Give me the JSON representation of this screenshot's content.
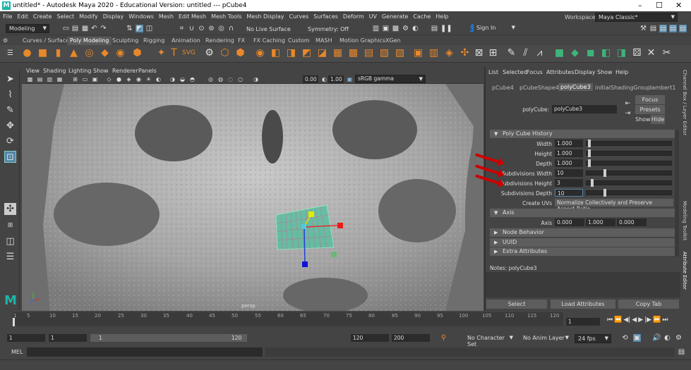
{
  "window": {
    "title": "untitled* - Autodesk Maya 2020 - Educational Version: untitled  ---  pCube4",
    "minimize": "–",
    "maximize": "☐",
    "close": "✕"
  },
  "menubar": [
    "File",
    "Edit",
    "Create",
    "Select",
    "Modify",
    "Display",
    "Windows",
    "Mesh",
    "Edit Mesh",
    "Mesh Tools",
    "Mesh Display",
    "Curves",
    "Surfaces",
    "Deform",
    "UV",
    "Generate",
    "Cache",
    "Help"
  ],
  "statusline": {
    "menuset": "Modeling",
    "live_surface": "No Live Surface",
    "symmetry": "Symmetry: Off",
    "sign_in": "Sign In",
    "workspace_label": "Workspace :",
    "workspace_value": "Maya Classic*"
  },
  "shelf_tabs": [
    "Curves / Surfaces",
    "Poly Modeling",
    "Sculpting",
    "Rigging",
    "Animation",
    "Rendering",
    "FX",
    "FX Caching",
    "Custom",
    "MASH",
    "Motion Graphics",
    "XGen"
  ],
  "shelf_active": "Poly Modeling",
  "viewport": {
    "menu": [
      "View",
      "Shading",
      "Lighting",
      "Show",
      "Renderer",
      "Panels"
    ],
    "exposure": "0.00",
    "gamma": "1.00",
    "colorspace": "sRGB gamma",
    "camera_label": "persp"
  },
  "attribute_editor": {
    "menu": [
      "List",
      "Selected",
      "Focus",
      "Attributes",
      "Display",
      "Show",
      "Help"
    ],
    "tabs": [
      "pCube4",
      "pCubeShape4",
      "polyCube3",
      "initialShadingGroup",
      "lambert1"
    ],
    "active_tab": "polyCube3",
    "node_label": "polyCube:",
    "node_value": "polyCube3",
    "focus_btn": "Focus",
    "presets_btn": "Presets",
    "show_btn": "Show",
    "hide_btn": "Hide",
    "history_section": "Poly Cube History",
    "attrs": [
      {
        "label": "Width",
        "value": "1.000"
      },
      {
        "label": "Height",
        "value": "1.000"
      },
      {
        "label": "Depth",
        "value": "1.000"
      },
      {
        "label": "Subdivisions Width",
        "value": "10"
      },
      {
        "label": "Subdivisions Height",
        "value": "3"
      },
      {
        "label": "Subdivisions Depth",
        "value": "10"
      }
    ],
    "create_uvs_label": "Create UVs",
    "create_uvs_value": "Normalize Collectively and Preserve Aspect Ratio",
    "axis_section": "Axis",
    "axis_label": "Axis",
    "axis_values": [
      "0.000",
      "1.000",
      "0.000"
    ],
    "collapsed_sections": [
      "Node Behavior",
      "UUID",
      "Extra Attributes"
    ],
    "notes_label": "Notes:  polyCube3",
    "bottom_buttons": [
      "Select",
      "Load Attributes",
      "Copy Tab"
    ]
  },
  "side_tabs": [
    "Channel Box / Layer Editor",
    "Modeling Toolkit",
    "Attribute Editor"
  ],
  "timeline": {
    "ticks": [
      "1",
      "5",
      "10",
      "15",
      "20",
      "25",
      "30",
      "35",
      "40",
      "45",
      "50",
      "55",
      "60",
      "65",
      "70",
      "75",
      "80",
      "85",
      "90",
      "95",
      "100",
      "105",
      "110",
      "115",
      "120"
    ],
    "current_frame": "1"
  },
  "range": {
    "start": "1",
    "playback_start": "1",
    "slider_start": "1",
    "slider_end": "120",
    "playback_end": "120",
    "end": "200",
    "character_set": "No Character Set",
    "anim_layer": "No Anim Layer",
    "fps": "24 fps"
  },
  "cmdline": {
    "label": "MEL"
  }
}
